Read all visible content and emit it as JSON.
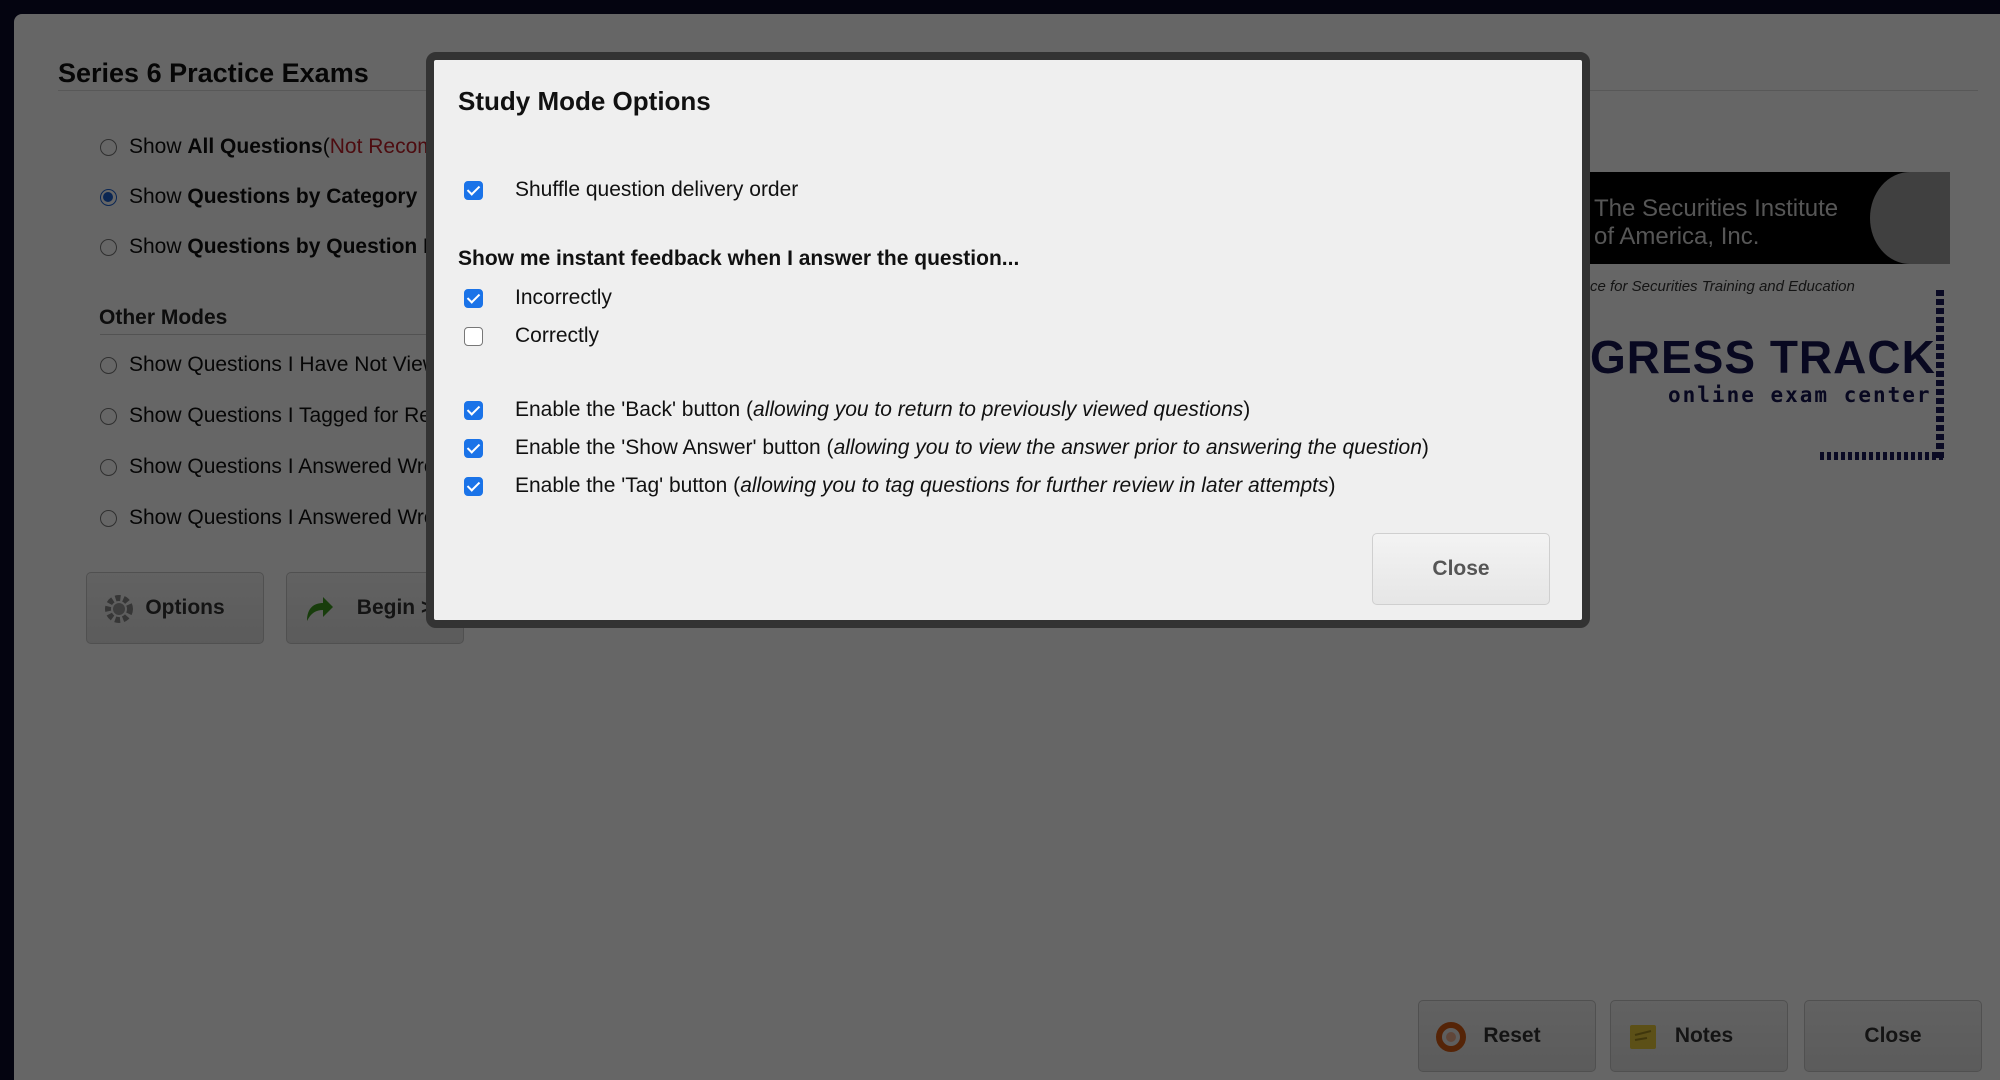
{
  "page": {
    "title": "Series 6 Practice Exams",
    "modes": [
      {
        "prefix": "Show ",
        "bold": "All Questions",
        "suffix": " (",
        "note": "Not Recommended)",
        "checked": false
      },
      {
        "prefix": "Show ",
        "bold": "Questions by Category",
        "suffix": "",
        "note": "",
        "checked": true
      },
      {
        "prefix": "Show ",
        "bold": "Questions by Question ID",
        "suffix": "",
        "note": "",
        "checked": false
      }
    ],
    "other_modes_title": "Other Modes",
    "other_modes": [
      {
        "label": "Show Questions I Have Not Viewed",
        "checked": false
      },
      {
        "label": "Show Questions I Tagged for Review",
        "checked": false
      },
      {
        "label": "Show Questions I Answered Wrong",
        "checked": false
      },
      {
        "label": "Show Questions I Answered Wrong",
        "checked": false
      }
    ],
    "buttons": {
      "options": "Options",
      "begin": "Begin >"
    },
    "footer_buttons": {
      "reset": "Reset",
      "notes": "Notes",
      "close": "Close"
    },
    "logo": {
      "line1": "The Securities Institute",
      "line2": "of America, Inc.",
      "tagline": "ce for Securities Training and Education",
      "big": "GRESS TRACK",
      "sub": "online exam center"
    }
  },
  "modal": {
    "title": "Study Mode Options",
    "shuffle": {
      "label": "Shuffle question delivery order",
      "checked": true
    },
    "feedback_heading": "Show me instant feedback when I answer the question...",
    "feedback": [
      {
        "label": "Incorrectly",
        "checked": true
      },
      {
        "label": "Correctly",
        "checked": false
      }
    ],
    "enable_options": [
      {
        "label": "Enable the 'Back' button (",
        "detail": "allowing you to return to previously viewed questions",
        "end": ")",
        "checked": true
      },
      {
        "label": "Enable the 'Show Answer' button (",
        "detail": "allowing you to view the answer prior to answering the question",
        "end": ")",
        "checked": true
      },
      {
        "label": "Enable the 'Tag' button (",
        "detail": "allowing you to tag questions for further review in later attempts",
        "end": ")",
        "checked": true
      }
    ],
    "close_label": "Close"
  }
}
